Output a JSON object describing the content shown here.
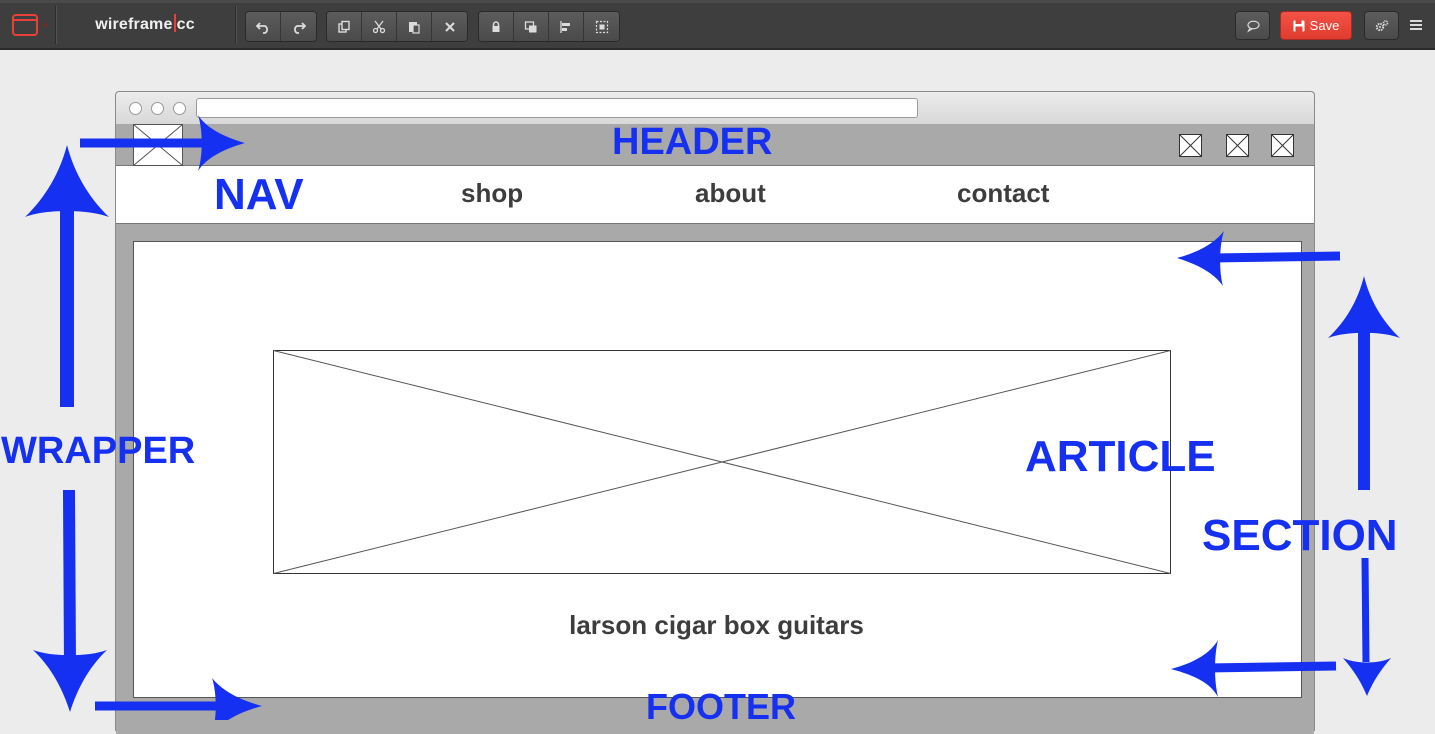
{
  "app": {
    "title_left": "wireframe",
    "title_right": "cc",
    "accent": "#e8413a"
  },
  "toolbar": {
    "save_label": "Save",
    "history_icons": [
      "undo-icon",
      "redo-icon"
    ],
    "edit_icons": [
      "copy-icon",
      "cut-icon",
      "paste-icon",
      "delete-icon"
    ],
    "arrange_icons": [
      "lock-icon",
      "bring-front-icon",
      "align-icon",
      "group-icon"
    ],
    "right_icons": [
      "comment-icon",
      "settings-icon",
      "menu-icon"
    ]
  },
  "wireframe": {
    "nav": {
      "items": [
        "shop",
        "about",
        "contact"
      ]
    },
    "article_caption": "larson cigar box guitars"
  },
  "annotations": {
    "color": "#1530f0",
    "header": "HEADER",
    "nav": "NAV",
    "wrapper": "WRAPPER",
    "article": "ARTICLE",
    "section": "SECTION",
    "footer": "FOOTER"
  }
}
